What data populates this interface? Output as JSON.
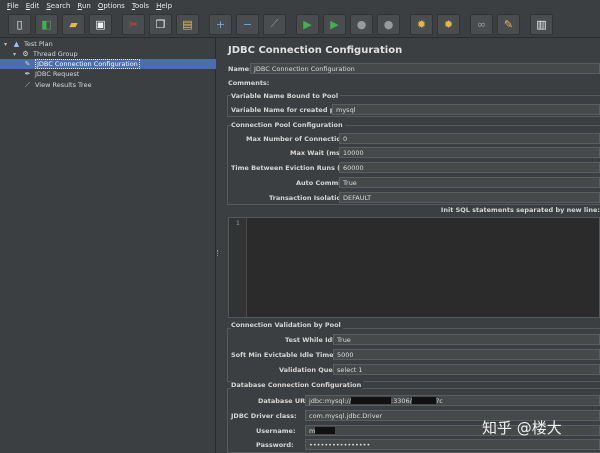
{
  "menu": [
    "File",
    "Edit",
    "Search",
    "Run",
    "Options",
    "Tools",
    "Help"
  ],
  "toolbar": [
    {
      "icon": "new-icon",
      "glyph": "▯"
    },
    {
      "icon": "templates-icon",
      "glyph": "◧"
    },
    {
      "icon": "open-icon",
      "glyph": "▰"
    },
    {
      "icon": "save-icon",
      "glyph": "▣"
    },
    {
      "icon": "cut-icon",
      "glyph": "✂"
    },
    {
      "icon": "copy-icon",
      "glyph": "❐"
    },
    {
      "icon": "paste-icon",
      "glyph": "▤"
    },
    {
      "icon": "expand-icon",
      "glyph": "+"
    },
    {
      "icon": "collapse-icon",
      "glyph": "−"
    },
    {
      "icon": "toggle-icon",
      "glyph": "⟋"
    },
    {
      "icon": "start-icon",
      "glyph": "▶"
    },
    {
      "icon": "start-no-pauses-icon",
      "glyph": "▶"
    },
    {
      "icon": "stop-icon",
      "glyph": "●"
    },
    {
      "icon": "shutdown-icon",
      "glyph": "●"
    },
    {
      "icon": "clear-icon",
      "glyph": "✹"
    },
    {
      "icon": "clear-all-icon",
      "glyph": "✹"
    },
    {
      "icon": "search-binoculars-icon",
      "glyph": "∞"
    },
    {
      "icon": "reset-search-icon",
      "glyph": "✎"
    },
    {
      "icon": "function-helper-icon",
      "glyph": "▥"
    },
    {
      "icon": "help-icon",
      "glyph": "?"
    }
  ],
  "tree": {
    "items": [
      "Test Plan",
      "Thread Group",
      "JDBC Connection Configuration",
      "JDBC Request",
      "View Results Tree"
    ]
  },
  "panel": {
    "title": "JDBC Connection Configuration",
    "name_label": "Name:",
    "name_value": "JDBC Connection Configuration",
    "comments_label": "Comments:",
    "pool_section": "Variable Name Bound to Pool",
    "pool_var_label": "Variable Name for created pool:",
    "pool_var_value": "mysql",
    "conn_section": "Connection Pool Configuration",
    "max_conn_label": "Max Number of Connections:",
    "max_conn_value": "0",
    "max_wait_label": "Max Wait (ms):",
    "max_wait_value": "10000",
    "eviction_label": "Time Between Eviction Runs (ms):",
    "eviction_value": "60000",
    "autocommit_label": "Auto Commit:",
    "autocommit_value": "True",
    "isolation_label": "Transaction Isolation:",
    "isolation_value": "DEFAULT",
    "sql_heading": "Init SQL statements separated by new line:",
    "sql_line_no": "1",
    "validation_section": "Connection Validation by Pool",
    "test_idle_label": "Test While Idle:",
    "test_idle_value": "True",
    "soft_min_label": "Soft Min Evictable Idle Time(ms):",
    "soft_min_value": "5000",
    "validation_query_label": "Validation Query:",
    "validation_query_value": "select 1",
    "db_section": "Database Connection Configuration",
    "db_url_label": "Database URL:",
    "db_url_prefix": "jdbc:mysql://",
    "db_url_mid": ":3306/",
    "db_url_suffix": "?c",
    "driver_label": "JDBC Driver class:",
    "driver_value": "com.mysql.jdbc.Driver",
    "username_label": "Username:",
    "username_value": "m",
    "password_label": "Password:",
    "password_value": "••••••••••••••••"
  },
  "watermark": "知乎 @楼大"
}
